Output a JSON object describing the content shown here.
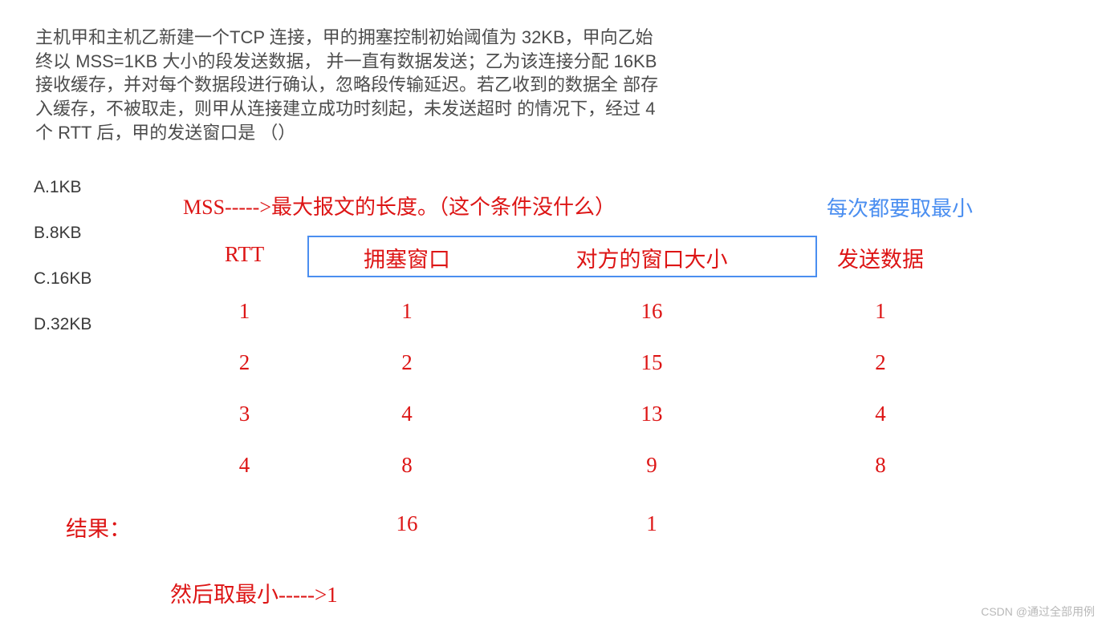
{
  "question": {
    "text": "主机甲和主机乙新建一个TCP 连接，甲的拥塞控制初始阈值为 32KB，甲向乙始终以 MSS=1KB 大小的段发送数据， 并一直有数据发送；乙为该连接分配 16KB 接收缓存，并对每个数据段进行确认，忽略段传输延迟。若乙收到的数据全 部存入缓存，不被取走，则甲从连接建立成功时刻起，未发送超时 的情况下，经过 4 个 RTT 后，甲的发送窗口是 （）"
  },
  "options": {
    "a": "A.1KB",
    "b": "B.8KB",
    "c": "C.16KB",
    "d": "D.32KB"
  },
  "note_mss": "MSS----->最大报文的长度。（这个条件没什么）",
  "note_blue": "每次都要取最小",
  "table": {
    "headers": {
      "c1": "RTT",
      "c2": "拥塞窗口",
      "c3": "对方的窗口大小",
      "c4": "发送数据"
    },
    "rows": [
      {
        "c1": "1",
        "c2": "1",
        "c3": "16",
        "c4": "1"
      },
      {
        "c1": "2",
        "c2": "2",
        "c3": "15",
        "c4": "2"
      },
      {
        "c1": "3",
        "c2": "4",
        "c3": "13",
        "c4": "4"
      },
      {
        "c1": "4",
        "c2": "8",
        "c3": "9",
        "c4": "8"
      }
    ],
    "result_label": "结果：",
    "result": {
      "c2": "16",
      "c3": "1"
    }
  },
  "bottom_note": "然后取最小----->1",
  "watermark": "CSDN @通过全部用例"
}
